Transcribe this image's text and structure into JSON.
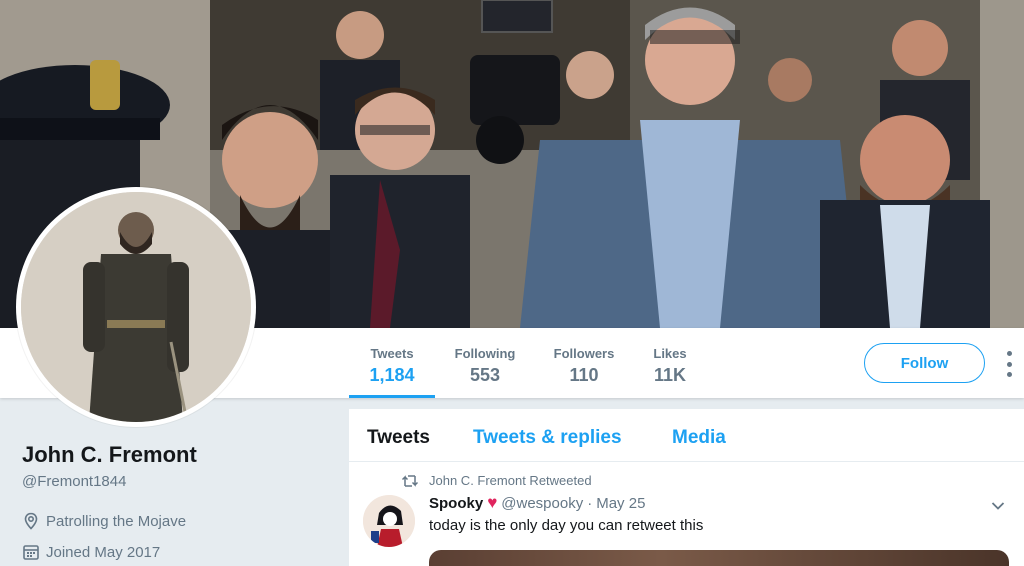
{
  "profile": {
    "name": "John C. Fremont",
    "handle": "@Fremont1844",
    "location": "Patrolling the Mojave",
    "joined": "Joined May 2017",
    "location_icon": "location-pin-icon",
    "joined_icon": "calendar-icon"
  },
  "stats": [
    {
      "label": "Tweets",
      "value": "1,184",
      "active": true
    },
    {
      "label": "Following",
      "value": "553",
      "active": false
    },
    {
      "label": "Followers",
      "value": "110",
      "active": false
    },
    {
      "label": "Likes",
      "value": "11K",
      "active": false
    }
  ],
  "actions": {
    "follow_label": "Follow",
    "more_icon": "vertical-dots-icon"
  },
  "tabs": [
    {
      "label": "Tweets",
      "active": true
    },
    {
      "label": "Tweets & replies",
      "active": false
    },
    {
      "label": "Media",
      "active": false
    }
  ],
  "tweet": {
    "retweet_context": "John C. Fremont Retweeted",
    "author_name": "Spooky",
    "author_emoji": "♥",
    "author_handle": "@wespooky",
    "separator": "·",
    "date": "May 25",
    "text": "today is the only day you can retweet this",
    "caret_icon": "chevron-down-icon",
    "retweet_icon": "retweet-icon"
  },
  "colors": {
    "accent": "#1da1f2",
    "secondary_text": "#657786",
    "primary_text": "#14171a",
    "heart": "#e0245e",
    "background": "#e6ecf0"
  }
}
